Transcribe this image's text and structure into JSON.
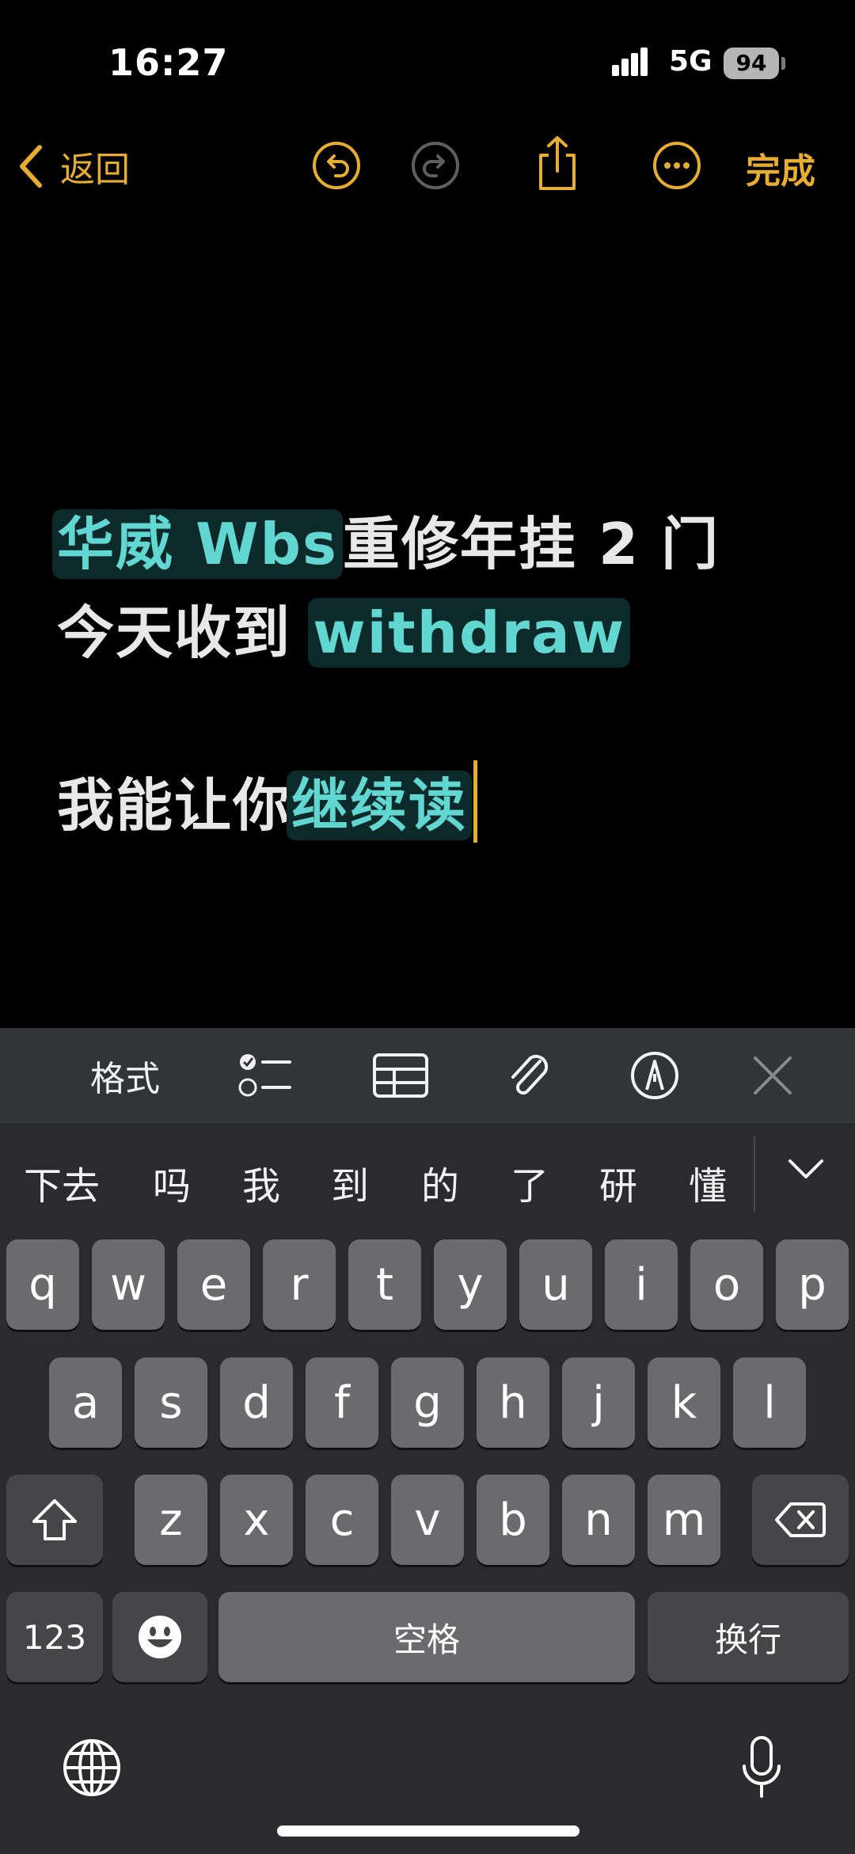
{
  "status_bar": {
    "time": "16:27",
    "network": "5G",
    "battery": "94"
  },
  "nav": {
    "back_label": "返回",
    "done_label": "完成"
  },
  "note": {
    "line1": {
      "hl": "华威 Wbs",
      "rest": "重修年挂 2 门"
    },
    "line2": {
      "pre": "今天收到 ",
      "hl": "withdraw"
    },
    "line3": {
      "pre": "我能让你",
      "hl": "继续读"
    }
  },
  "toolbar": {
    "format_label": "格式",
    "icons": [
      "checklist-icon",
      "table-icon",
      "paperclip-icon",
      "markup-pen-icon",
      "close-icon"
    ]
  },
  "candidates": [
    "下去",
    "吗",
    "我",
    "到",
    "的",
    "了",
    "研",
    "懂"
  ],
  "keyboard": {
    "row1": [
      "q",
      "w",
      "e",
      "r",
      "t",
      "y",
      "u",
      "i",
      "o",
      "p"
    ],
    "row2": [
      "a",
      "s",
      "d",
      "f",
      "g",
      "h",
      "j",
      "k",
      "l"
    ],
    "row3": [
      "z",
      "x",
      "c",
      "v",
      "b",
      "n",
      "m"
    ],
    "numbers_label": "123",
    "space_label": "空格",
    "return_label": "换行"
  }
}
